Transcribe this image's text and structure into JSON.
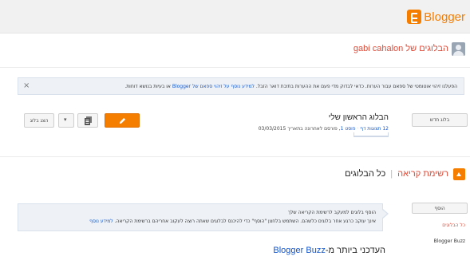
{
  "header": {
    "logo_text": "Blogger"
  },
  "user": {
    "title": "הבלוגים של gabi cahalon"
  },
  "notice": {
    "text_before": "הפעלנו זיהוי אוטומטי של ספאם עבור הערות. כדאי לבדוק מדי פעם את ההערות בתיבת דואר הזבל. ",
    "link_text": "למידע נוסף על זיהוי ספאם של Blogger",
    "text_after": " או בעיות בנושא דוחות.",
    "close": "×"
  },
  "blogs": {
    "new_blog_button": "בלוג חדש",
    "items": [
      {
        "title": "הבלוג הראשון שלי",
        "pageviews": "12 תצוגות דף",
        "posts": "פוסט 1",
        "last_published": ", פורסם לאחרונה בתאריך 03/03/2015",
        "view_blog_button": "הצג בלוג",
        "dropdown_arrow": "▾"
      }
    ]
  },
  "reading_list": {
    "title": "רשימת קריאה",
    "all_blogs": "כל הבלוגים",
    "add_button": "הוסף",
    "sidebar_links": [
      "כל הבלוגים",
      "Blogger Buzz"
    ],
    "tip_line1": "הוסף בלוגים למעקב לרשימת הקריאה שלך",
    "tip_line2": "אינך עוקב כרגע אחר בלוגים כלשהם. השתמש בלחצן \"הוסף\" כדי להיכנס לבלוגים שאתה רוצה לעקוב אחריהם ברשימת הקריאה. ",
    "tip_link": "למידע נוסף",
    "latest_prefix": "העדכני ביותר מ-",
    "latest_source": "Blogger Buzz"
  },
  "colors": {
    "accent": "#f57d00",
    "link": "#1155cc",
    "title_red": "#dd4b39"
  }
}
